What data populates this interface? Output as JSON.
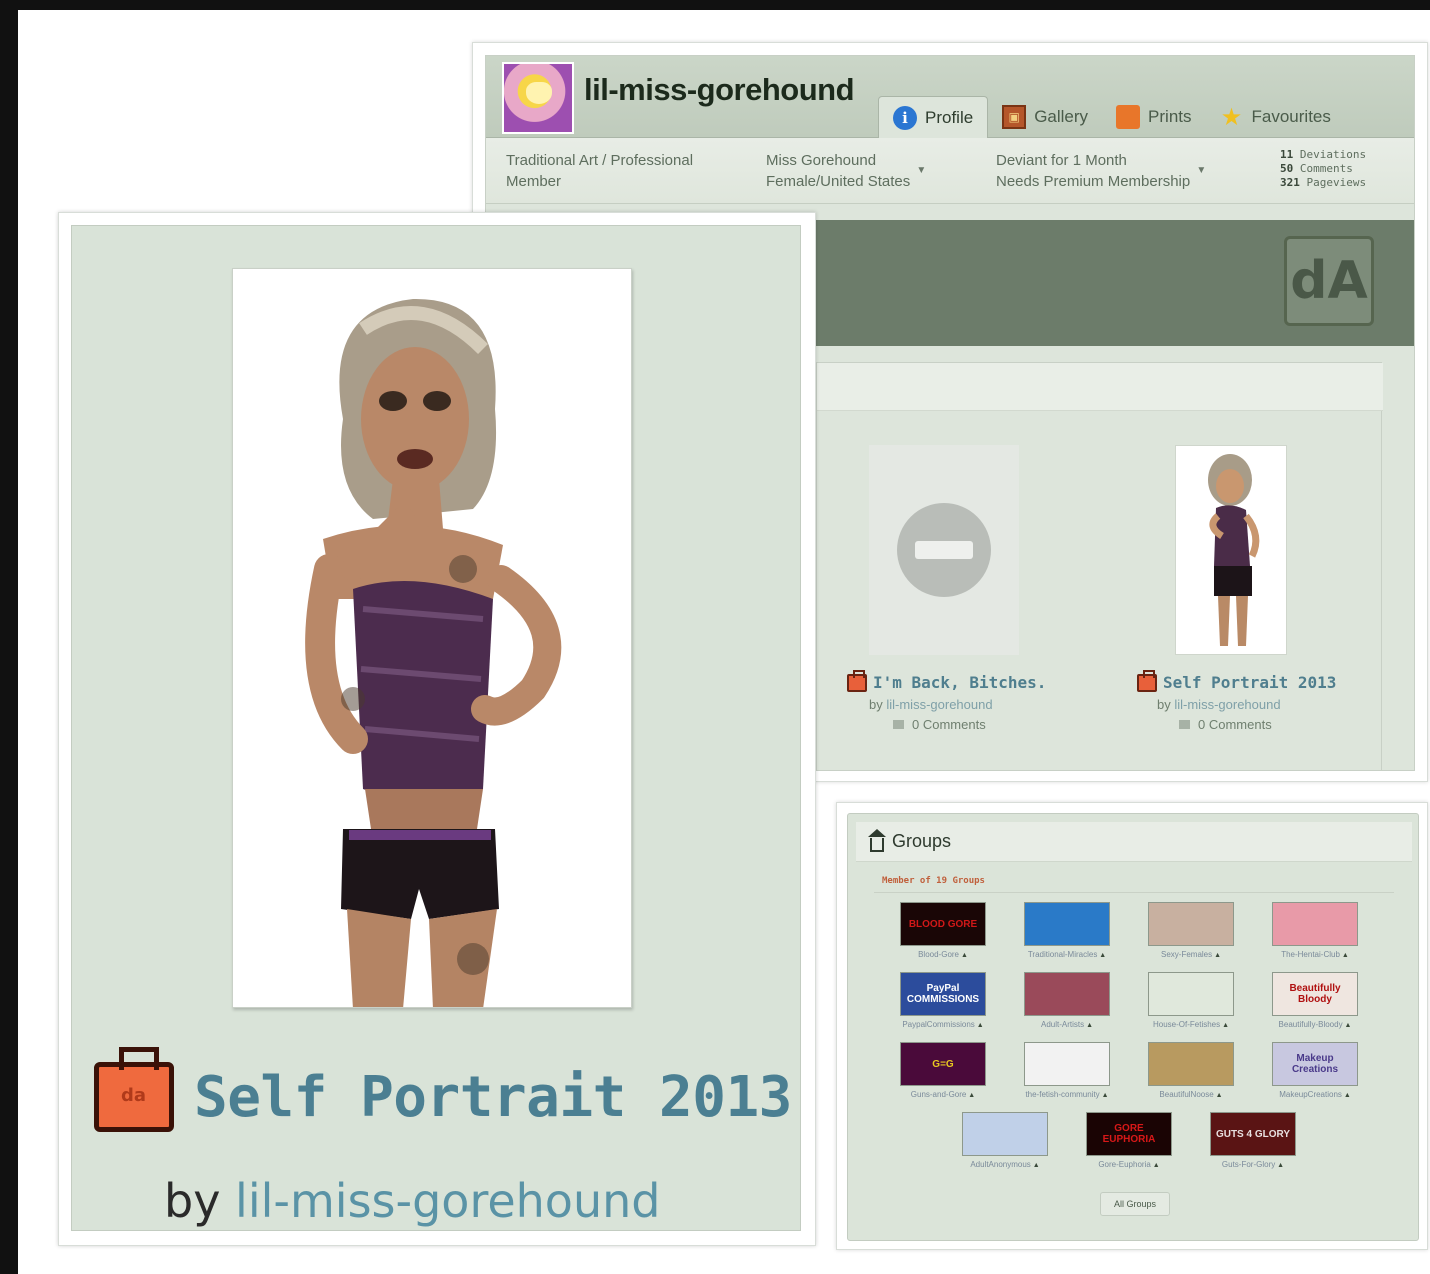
{
  "profile": {
    "username": "lil-miss-gorehound",
    "tabs": [
      {
        "label": "Profile",
        "icon": "info-icon",
        "active": true
      },
      {
        "label": "Gallery",
        "icon": "gallery-icon",
        "active": false
      },
      {
        "label": "Prints",
        "icon": "prints-icon",
        "active": false
      },
      {
        "label": "Favourites",
        "icon": "star-icon",
        "active": false
      }
    ],
    "meta": {
      "role_line1": "Traditional Art / Professional",
      "role_line2": "Member",
      "name_line1": "Miss Gorehound",
      "name_line2": "Female/United States",
      "deviant_line1": "Deviant for 1 Month",
      "deviant_line2": "Needs Premium Membership"
    },
    "stats": {
      "deviations_count": "11",
      "deviations_label": "Deviations",
      "comments_count": "50",
      "comments_label": "Comments",
      "pageviews_count": "321",
      "pageviews_label": "Pageviews"
    },
    "deviations": [
      {
        "title": "I'm Back, Bitches.",
        "by": "by",
        "author": "lil-miss-gorehound",
        "comments": "0 Comments"
      },
      {
        "title": "Self Portrait 2013",
        "by": "by",
        "author": "lil-miss-gorehound",
        "comments": "0 Comments"
      }
    ]
  },
  "feature": {
    "title": "Self Portrait 2013",
    "by": "by",
    "author": "lil-miss-gorehound"
  },
  "groups": {
    "heading": "Groups",
    "member_of": "Member of 19 Groups",
    "all_groups": "All Groups",
    "items": [
      {
        "name": "Blood-Gore",
        "thumb_text": "BLOOD GORE",
        "bg": "#1a0606",
        "fg": "#d01818"
      },
      {
        "name": "Traditional-Miracles",
        "thumb_text": "",
        "bg": "#2a7ac8",
        "fg": "#ffffff"
      },
      {
        "name": "Sexy-Females",
        "thumb_text": "",
        "bg": "#c8b0a0",
        "fg": "#ffffff"
      },
      {
        "name": "The-Hentai-Club",
        "thumb_text": "",
        "bg": "#e89aa8",
        "fg": "#ffffff"
      },
      {
        "name": "PaypalCommissions",
        "thumb_text": "PayPal COMMISSIONS",
        "bg": "#2c4c9c",
        "fg": "#ffffff"
      },
      {
        "name": "Adult-Artists",
        "thumb_text": "",
        "bg": "#9a4a5a",
        "fg": "#ffffff"
      },
      {
        "name": "House-Of-Fetishes",
        "thumb_text": "",
        "bg": "#e0e8dc",
        "fg": "#3a0a2a"
      },
      {
        "name": "Beautifully-Bloody",
        "thumb_text": "Beautifully Bloody",
        "bg": "#efe6e0",
        "fg": "#b01010"
      },
      {
        "name": "Guns-and-Gore",
        "thumb_text": "G=G",
        "bg": "#4a0a3a",
        "fg": "#e8c820"
      },
      {
        "name": "the-fetish-community",
        "thumb_text": "",
        "bg": "#f2f2f2",
        "fg": "#111111"
      },
      {
        "name": "BeautifulNoose",
        "thumb_text": "",
        "bg": "#b89a60",
        "fg": "#3a2a10"
      },
      {
        "name": "MakeupCreations",
        "thumb_text": "Makeup Creations",
        "bg": "#c8c8e0",
        "fg": "#4a3a8a"
      },
      {
        "name": "AdultAnonymous",
        "thumb_text": "",
        "bg": "#c0d0e8",
        "fg": "#c03018"
      },
      {
        "name": "Gore-Euphoria",
        "thumb_text": "GORE EUPHORIA",
        "bg": "#1a0404",
        "fg": "#d81818"
      },
      {
        "name": "Guts-For-Glory",
        "thumb_text": "GUTS 4 GLORY",
        "bg": "#5a1414",
        "fg": "#e8e0e0"
      }
    ]
  }
}
